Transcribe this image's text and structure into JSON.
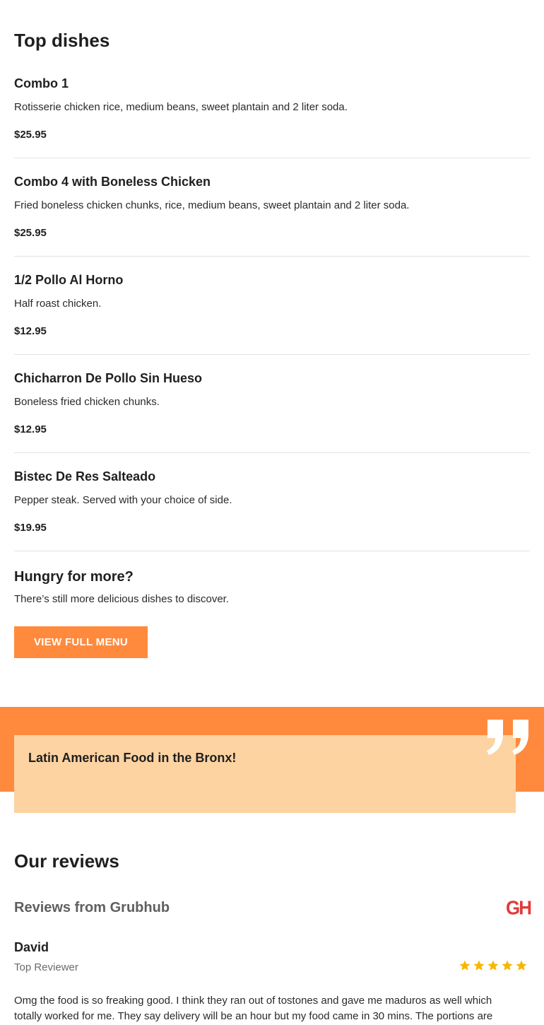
{
  "top_dishes": {
    "title": "Top dishes",
    "items": [
      {
        "name": "Combo 1",
        "description": "Rotisserie chicken rice, medium beans, sweet plantain and 2 liter soda.",
        "price": "$25.95"
      },
      {
        "name": "Combo 4 with Boneless Chicken",
        "description": "Fried boneless chicken chunks, rice, medium beans, sweet plantain and 2 liter soda.",
        "price": "$25.95"
      },
      {
        "name": "1/2 Pollo Al Horno",
        "description": "Half roast chicken.",
        "price": "$12.95"
      },
      {
        "name": "Chicharron De Pollo Sin Hueso",
        "description": "Boneless fried chicken chunks.",
        "price": "$12.95"
      },
      {
        "name": "Bistec De Res Salteado",
        "description": "Pepper steak. Served with your choice of side.",
        "price": "$19.95"
      }
    ]
  },
  "more": {
    "title": "Hungry for more?",
    "subtitle": "There’s still more delicious dishes to discover.",
    "button_label": "VIEW FULL MENU"
  },
  "quote": {
    "text": "Latin American Food in the Bronx!",
    "icon": "quote-icon"
  },
  "reviews": {
    "title": "Our reviews",
    "source_label": "Reviews from Grubhub",
    "source_logo": "GH",
    "review": {
      "author": "David",
      "badge": "Top Reviewer",
      "rating": 5,
      "text": "Omg the food is so freaking good. I think they ran out of tostones and gave me maduros as well which totally worked for me. They say delivery will be an hour but my food came in 30 mins. The portions are"
    }
  },
  "colors": {
    "accent": "#ff8a3d",
    "quote_card": "#fdd3a2",
    "star": "#f5b800",
    "grubhub_red": "#e23a3a"
  }
}
